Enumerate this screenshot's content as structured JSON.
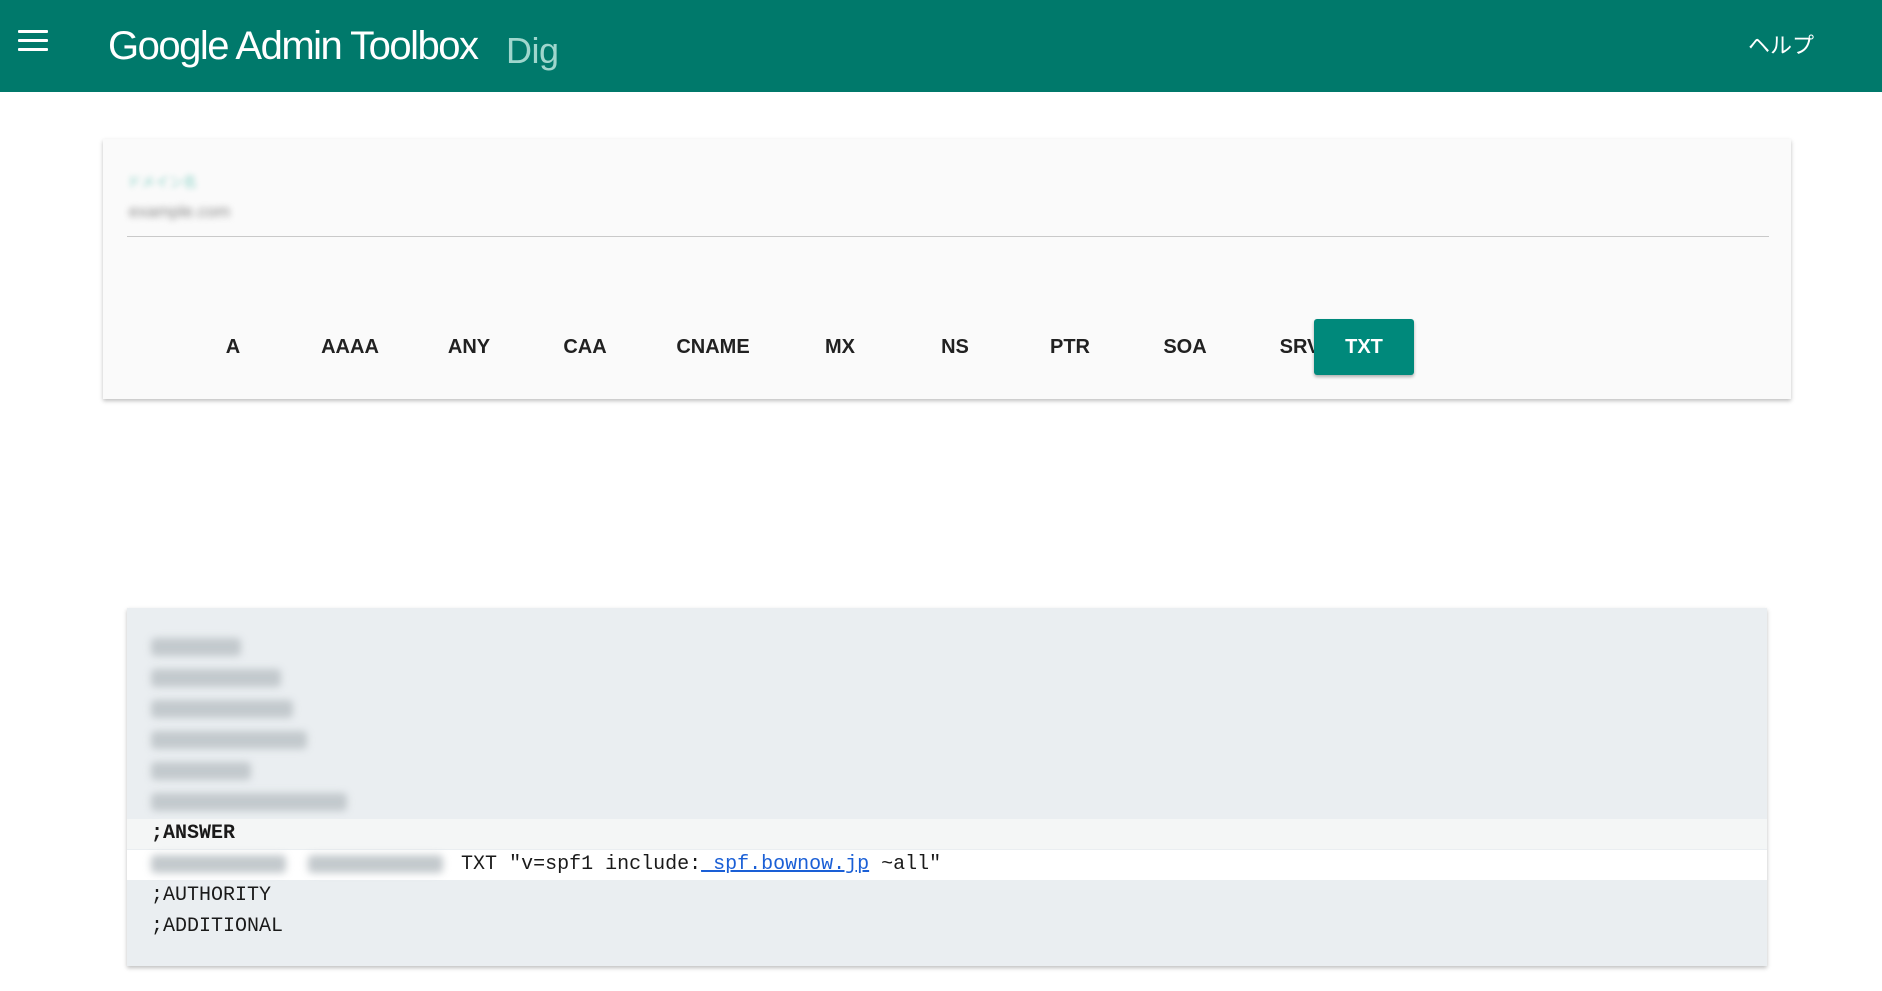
{
  "header": {
    "title": "Google Admin Toolbox",
    "subtitle": "Dig",
    "help_label": "ヘルプ"
  },
  "search": {
    "label": "ドメイン名",
    "value": "example.com"
  },
  "record_types": [
    "A",
    "AAAA",
    "ANY",
    "CAA",
    "CNAME",
    "MX",
    "NS",
    "PTR",
    "SOA",
    "SRV",
    "TXT"
  ],
  "selected_type": "TXT",
  "result": {
    "answer_header": ";ANSWER",
    "answer_type": "TXT",
    "answer_prefix": "\"v=spf1 include:",
    "answer_link": "_spf.bownow.jp",
    "answer_suffix": " ~all\"",
    "authority_header": ";AUTHORITY",
    "additional_header": ";ADDITIONAL"
  },
  "colors": {
    "topbar": "#00796b",
    "accent": "#00897b",
    "result_bg": "#eaeef1",
    "link": "#1a5fd6"
  },
  "icons": {
    "menu": "hamburger-menu-icon"
  }
}
